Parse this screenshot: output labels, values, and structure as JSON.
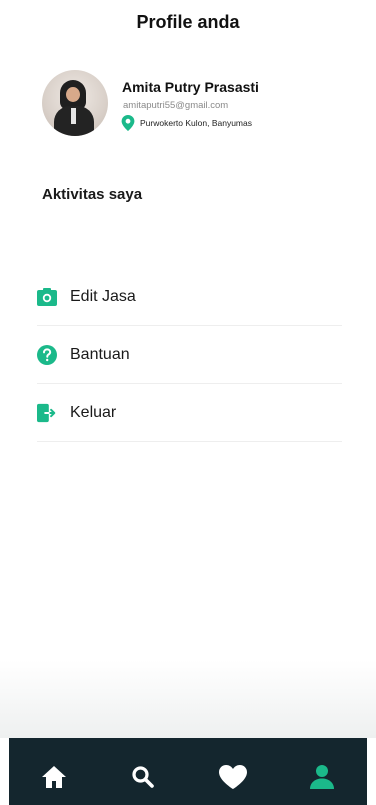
{
  "header": {
    "title": "Profile anda"
  },
  "profile": {
    "name": "Amita Putry Prasasti",
    "email": "amitaputri55@gmail.com",
    "location": "Purwokerto Kulon, Banyumas"
  },
  "activities": {
    "title": "Aktivitas saya"
  },
  "menu": [
    {
      "label": "Edit Jasa",
      "icon": "camera-icon"
    },
    {
      "label": "Bantuan",
      "icon": "help-icon"
    },
    {
      "label": "Keluar",
      "icon": "logout-icon"
    }
  ],
  "bottom_nav": {
    "items": [
      {
        "icon": "home-icon",
        "active": false
      },
      {
        "icon": "search-icon",
        "active": false
      },
      {
        "icon": "heart-icon",
        "active": false
      },
      {
        "icon": "user-icon",
        "active": true
      }
    ]
  },
  "colors": {
    "accent": "#1bb98a",
    "nav_background": "#14262e",
    "nav_icon": "#ffffff"
  }
}
